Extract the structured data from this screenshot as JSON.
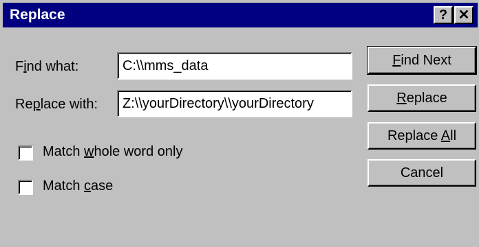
{
  "window": {
    "title": "Replace",
    "help_label": "?",
    "close_label": "✕"
  },
  "find": {
    "label_pre": "F",
    "label_ul": "i",
    "label_post": "nd what:",
    "value": "C:\\\\mms_data"
  },
  "replace": {
    "label_pre": "Re",
    "label_ul": "p",
    "label_post": "lace with:",
    "value": "Z:\\\\yourDirectory\\\\yourDirectory"
  },
  "options": {
    "whole_word": {
      "pre": "Match ",
      "ul": "w",
      "post": "hole word only",
      "checked": false
    },
    "match_case": {
      "pre": "Match ",
      "ul": "c",
      "post": "ase",
      "checked": false
    }
  },
  "buttons": {
    "find_next": {
      "ul": "F",
      "post": "ind Next"
    },
    "replace": {
      "ul": "R",
      "post": "eplace"
    },
    "replace_all": {
      "pre": "Replace ",
      "ul": "A",
      "post": "ll"
    },
    "cancel": {
      "label": "Cancel"
    }
  },
  "colors": {
    "title_bar": "#000080",
    "face": "#c0c0c0"
  }
}
